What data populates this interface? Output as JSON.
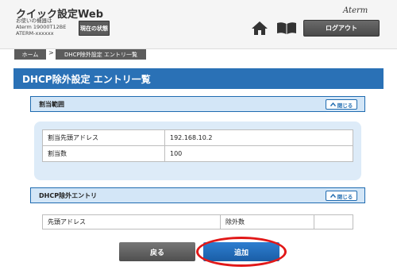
{
  "header": {
    "app_title": "クイック設定Web",
    "device_line1": "お使いの機器は",
    "device_line2": "Aterm 19000T12BE",
    "device_line3": "ATERM-xxxxxx",
    "status_button": "現在の状態",
    "brand": "Aterm",
    "home_icon": "home-icon",
    "manual_icon": "book-icon",
    "logout_button": "ログアウト"
  },
  "breadcrumb": {
    "home": "ホーム",
    "separator": ">",
    "current": "DHCP除外設定 エントリ一覧"
  },
  "page": {
    "title": "DHCP除外設定 エントリ一覧"
  },
  "range_section": {
    "title": "割当範囲",
    "collapse": "閉じる",
    "rows": [
      {
        "label": "割当先頭アドレス",
        "value": "192.168.10.2"
      },
      {
        "label": "割当数",
        "value": "100"
      }
    ]
  },
  "entry_section": {
    "title": "DHCP除外エントリ",
    "collapse": "閉じる",
    "columns": [
      "先頭アドレス",
      "除外数",
      ""
    ]
  },
  "actions": {
    "back": "戻る",
    "add": "追加"
  },
  "colors": {
    "accent_blue": "#2a71b6",
    "panel_blue": "#ddebf8",
    "highlight_red": "#e11818"
  }
}
